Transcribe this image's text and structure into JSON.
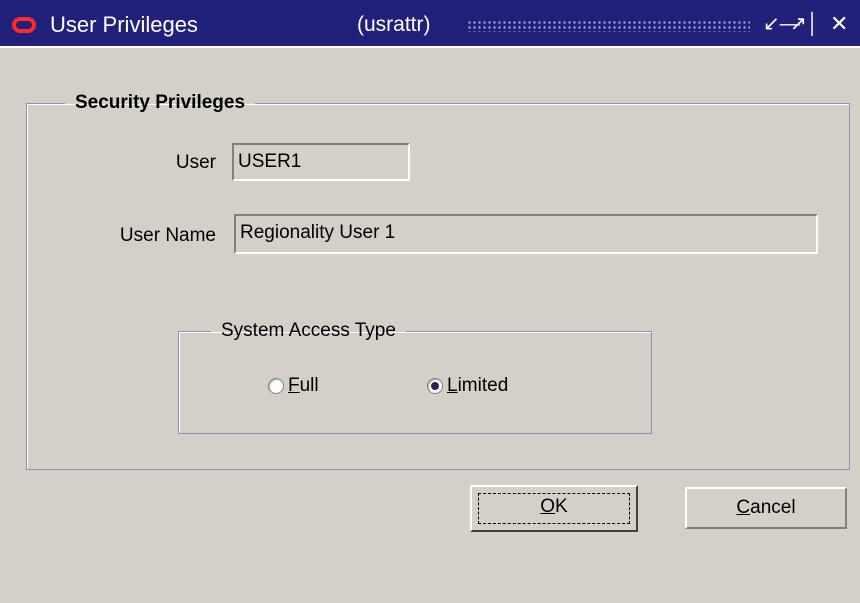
{
  "window": {
    "title": "User Privileges",
    "form_code": "(usrattr)",
    "controls": {
      "minimize_icon": "minimize-icon",
      "maximize_icon": "maximize-icon",
      "close_icon": "close-icon"
    }
  },
  "security_group": {
    "legend": "Security Privileges",
    "user_label": "User",
    "user_value": "USER1",
    "user_name_label": "User Name",
    "user_name_value": "Regionality User 1"
  },
  "access_group": {
    "legend": "System Access Type",
    "options": [
      {
        "label_prefix": "",
        "label_mnemonic": "F",
        "label_rest": "ull",
        "selected": false
      },
      {
        "label_prefix": "",
        "label_mnemonic": "L",
        "label_rest": "imited",
        "selected": true
      }
    ]
  },
  "buttons": {
    "ok_mnemonic": "O",
    "ok_rest": "K",
    "cancel_mnemonic": "C",
    "cancel_rest": "ancel"
  },
  "colors": {
    "titlebar": "#21217c",
    "window_bg": "#d4d0c8",
    "app_icon": "#ff2a2a"
  }
}
